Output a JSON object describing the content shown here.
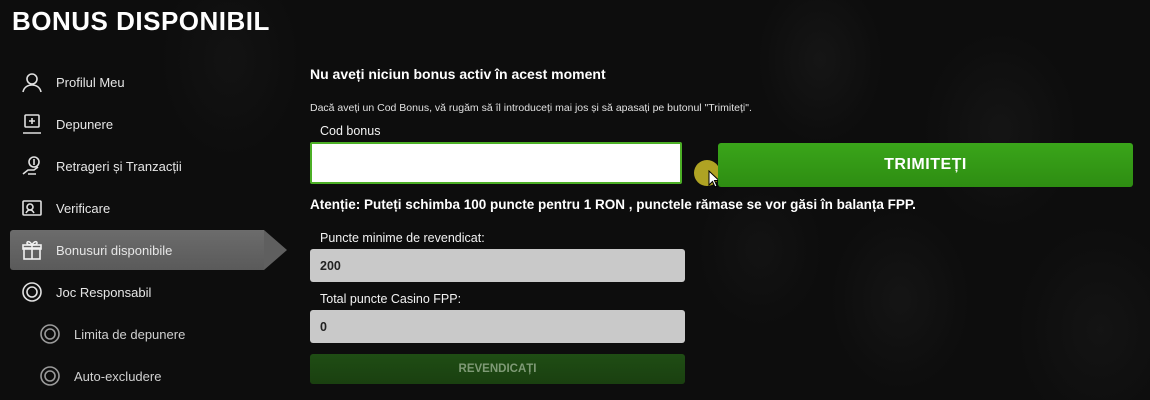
{
  "page": {
    "title": "BONUS DISPONIBIL"
  },
  "sidebar": {
    "items": [
      {
        "label": "Profilul Meu",
        "icon": "user-icon"
      },
      {
        "label": "Depunere",
        "icon": "deposit-icon"
      },
      {
        "label": "Retrageri și Tranzacții",
        "icon": "withdraw-icon"
      },
      {
        "label": "Verificare",
        "icon": "id-card-icon"
      },
      {
        "label": "Bonusuri disponibile",
        "icon": "gift-icon",
        "active": true
      },
      {
        "label": "Joc Responsabil",
        "icon": "responsible-gaming-icon"
      },
      {
        "label": "Limita de depunere",
        "icon": "limit-icon",
        "sub": true
      },
      {
        "label": "Auto-excludere",
        "icon": "self-exclusion-icon",
        "sub": true
      }
    ]
  },
  "main": {
    "headline": "Nu aveți niciun bonus activ în acest moment",
    "info": "Dacă aveți un Cod Bonus, vă rugăm să îl introduceți mai jos și să apasați pe butonul \"Trimiteți\".",
    "code_label": "Cod bonus",
    "code_value": "",
    "submit_label": "TRIMITEȚI",
    "notice": "Atenție: Puteți schimba 100 puncte pentru 1 RON , punctele rămase se vor găsi în balanța FPP.",
    "min_points_label": "Puncte minime de revendicat:",
    "min_points_value": "200",
    "total_points_label": "Total puncte Casino FPP:",
    "total_points_value": "0",
    "claim_label": "REVENDICAȚI"
  },
  "colors": {
    "accent_green": "#35a016",
    "disabled_green": "#1d4712",
    "active_nav": "#616161"
  }
}
